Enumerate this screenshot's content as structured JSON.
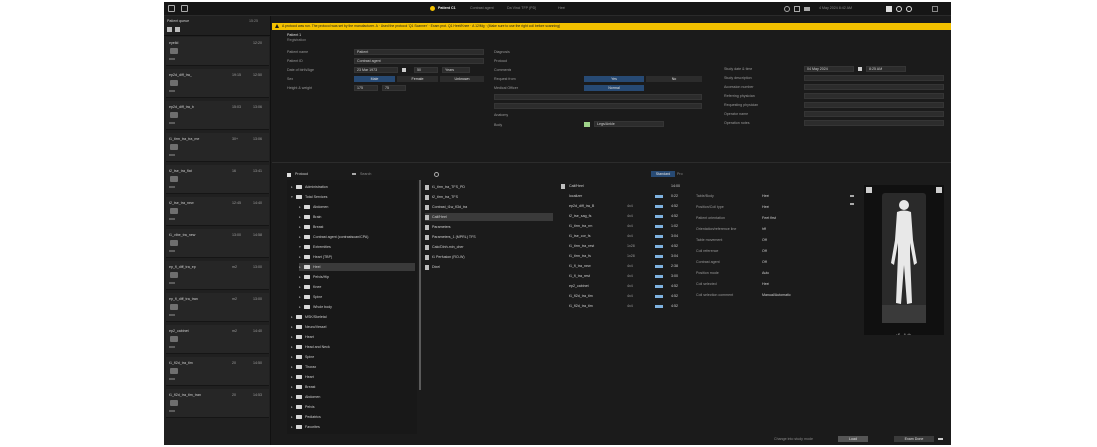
{
  "topbar": {
    "title": "Patient C1",
    "crumbs": [
      "Contrast agent",
      "Da Vinci TFP (PD)",
      "Heel"
    ],
    "clock": "4 May 2024  8:42 AM"
  },
  "leftpanel": {
    "header": "Patient queue",
    "header_date": "15:25",
    "items": [
      {
        "name": "eyelid",
        "code": "",
        "date": "12:20"
      },
      {
        "name": "ep2d_diff_tra_",
        "code": "19:15",
        "date": "12:50"
      },
      {
        "name": "ep2d_diff_tra_b",
        "code": "15:03",
        "date": "13:06"
      },
      {
        "name": "t1_tirm_tra_tra_me",
        "code": "30+",
        "date": "13:06"
      },
      {
        "name": "t2_tse_tra_flat",
        "code": "16",
        "date": "13:41"
      },
      {
        "name": "t2_tse_tra_new",
        "code": "12:45",
        "date": "14:40"
      },
      {
        "name": "t1_vibe_tra_new",
        "code": "13:00",
        "date": "14:58"
      },
      {
        "name": "ep_fl_diff_tra_ep",
        "code": "m2",
        "date": "13:00"
      },
      {
        "name": "ep_fl_diff_tra_tran",
        "code": "m2",
        "date": "13:00"
      },
      {
        "name": "ep2_cabinet",
        "code": "m2",
        "date": "14:40"
      },
      {
        "name": "t1_fl2d_tra_tim",
        "code": "20",
        "date": "14:50"
      },
      {
        "name": "t1_fl2d_tra_tim_tran",
        "code": "20",
        "date": "14:53"
      }
    ]
  },
  "banner": {
    "text": "A protocol was run. The protocol was set by the manufacturer. A · Used the protocol 'Q1 Scanner' · Exam prot. Q1 Heel/Knee · A 12/Mg · (Make sure to use the right coil before scanning)"
  },
  "form": {
    "tab": "Patient 1",
    "sub": "Registration",
    "fields": [
      {
        "label": "Patient name",
        "value": "Patient"
      },
      {
        "label": "Patient ID",
        "value": "Contrast agent"
      },
      {
        "label": "Date of birth/Age",
        "value": "23 Mar 1973"
      },
      {
        "label": "Sex",
        "value": ""
      },
      {
        "label": "Height & weight",
        "value": ""
      }
    ],
    "age_value": "50",
    "age_unit": "Years",
    "sex_options": [
      "Male",
      "Female",
      "Unknown"
    ],
    "height": "175",
    "weight": "75",
    "mid_labels": [
      "Diagnosis",
      "Protocol",
      "Comments",
      "Request from",
      "Medical Officer",
      "Anatomy",
      "Body"
    ],
    "toggles": [
      "Yes",
      "No",
      "Normal",
      "2"
    ],
    "region_select": "Legs/Ankle",
    "right_labels": [
      "Study date & time",
      "Study description",
      "Accession number",
      "Referring physician",
      "Requesting physician",
      "Operator name",
      "Operation notes"
    ],
    "study_date": "04 May 2024",
    "study_time": "8:25 AM"
  },
  "tree": {
    "selector": "Protocol",
    "search_placeholder": "Search",
    "rows": [
      {
        "label": "Administration",
        "depth": 0,
        "open": false
      },
      {
        "label": "Total Services",
        "depth": 0,
        "open": true
      },
      {
        "label": "Abdomen",
        "depth": 1,
        "open": false
      },
      {
        "label": "Brain",
        "depth": 1,
        "open": false
      },
      {
        "label": "Breast",
        "depth": 1,
        "open": false
      },
      {
        "label": "Contrast agent (contrastscan/CPA)",
        "depth": 1,
        "open": false
      },
      {
        "label": "Extremities",
        "depth": 1,
        "open": true
      },
      {
        "label": "Heart (TBP)",
        "depth": 1,
        "open": false
      },
      {
        "label": "Heel",
        "depth": 1,
        "open": false,
        "selected": true
      },
      {
        "label": "Pelvis/Hip",
        "depth": 1,
        "open": false
      },
      {
        "label": "Knee",
        "depth": 1,
        "open": false
      },
      {
        "label": "Spine",
        "depth": 1,
        "open": false
      },
      {
        "label": "Whole body",
        "depth": 1,
        "open": false
      },
      {
        "label": "MSK/Skeletal",
        "depth": 0,
        "open": false
      },
      {
        "label": "Neuro/Vessel",
        "depth": 0,
        "open": false
      },
      {
        "label": "Heart",
        "depth": 0,
        "open": false
      },
      {
        "label": "Head and Neck",
        "depth": 0,
        "open": false
      },
      {
        "label": "Spine",
        "depth": 0,
        "open": false
      },
      {
        "label": "Thorax",
        "depth": 0,
        "open": false
      },
      {
        "label": "Heart",
        "depth": 0,
        "open": false
      },
      {
        "label": "Breast",
        "depth": 0,
        "open": false
      },
      {
        "label": "Abdomen",
        "depth": 0,
        "open": false
      },
      {
        "label": "Pelvis",
        "depth": 0,
        "open": false
      },
      {
        "label": "Pediatrics",
        "depth": 0,
        "open": false
      },
      {
        "label": "Favorites",
        "depth": 0,
        "open": false
      }
    ]
  },
  "protocols": [
    {
      "label": "t1_tirm_tra_TFS_PD",
      "selected": false
    },
    {
      "label": "t2_tirm_tra_TFS",
      "selected": false
    },
    {
      "label": "Contrast_t1w_fl3d_tra",
      "selected": false
    },
    {
      "label": "Calf/Heel",
      "selected": true
    },
    {
      "label": "Parameters",
      "selected": false
    },
    {
      "label": "Parameters_1 (MPRL) TFS",
      "selected": false
    },
    {
      "label": "Calc/Dinh-min_cher",
      "selected": false
    },
    {
      "label": "t1 Perfusion (RO-W)",
      "selected": false
    },
    {
      "label": "Dixel",
      "selected": false
    }
  ],
  "series": {
    "header": {
      "name": "Calf/Heel",
      "time": "14:00"
    },
    "rows": [
      {
        "name": "localizer",
        "size": "",
        "time": "0:22"
      },
      {
        "name": "ep2d_diff_tra_B",
        "size": "4x4",
        "time": "4:52"
      },
      {
        "name": "t2_tse_sag_fs",
        "size": "4x4",
        "time": "4:52"
      },
      {
        "name": "t1_tirm_tra_rm",
        "size": "4x4",
        "time": "1:02"
      },
      {
        "name": "t1_tse_cor_fs",
        "size": "4x4",
        "time": "3:04"
      },
      {
        "name": "t1_tirm_tra_rest",
        "size": "1x28",
        "time": "4:52"
      },
      {
        "name": "t1_tirm_tra_fs",
        "size": "1x28",
        "time": "3:04"
      },
      {
        "name": "t1_fl_tra_new",
        "size": "4x4",
        "time": "2:38"
      },
      {
        "name": "t1_fl_tra_rest",
        "size": "4x4",
        "time": "3:00"
      },
      {
        "name": "ep2_cabinet",
        "size": "4x4",
        "time": "4:52"
      },
      {
        "name": "t1_fl2d_tra_tim",
        "size": "4x4",
        "time": "4:52"
      },
      {
        "name": "t1_fl2d_tra_tim",
        "size": "4x4",
        "time": "4:52"
      }
    ],
    "tab_active": "Standard",
    "tab_other": "Pro"
  },
  "properties": [
    {
      "label": "Table/Body",
      "value": "Heel"
    },
    {
      "label": "Position/Coil type",
      "value": "Heel"
    },
    {
      "label": "Patient orientation",
      "value": "Feet first"
    },
    {
      "label": "Orientation/reference line",
      "value": "hff"
    },
    {
      "label": "Table movement",
      "value": "Off"
    },
    {
      "label": "Coil reference",
      "value": "Off"
    },
    {
      "label": "Contrast agent",
      "value": "Off"
    },
    {
      "label": "Position mode",
      "value": "Auto"
    },
    {
      "label": "Coil selected",
      "value": "Heel"
    },
    {
      "label": "Coil selection comment",
      "value": "Manual/Automatic"
    }
  ],
  "bottom": {
    "note": "Change into study mode",
    "btn1": "Load",
    "btn2": "Exam Done"
  },
  "colors": {
    "banner": "#f3c100",
    "accent": "#274a74",
    "background": "#1b1b1b"
  }
}
